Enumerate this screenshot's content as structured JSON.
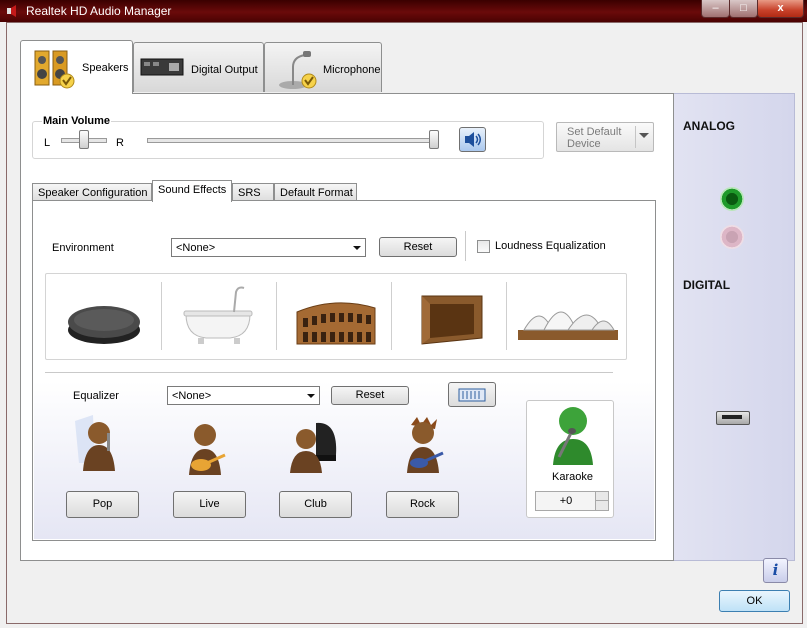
{
  "window": {
    "title": "Realtek HD Audio Manager",
    "minimize": "–",
    "maximize": "□",
    "close": "x"
  },
  "tabs": [
    {
      "label": "Speakers",
      "icon": "speakers-icon"
    },
    {
      "label": "Digital Output",
      "icon": "digital-output-icon"
    },
    {
      "label": "Microphone",
      "icon": "microphone-icon"
    }
  ],
  "volume": {
    "title": "Main Volume",
    "left": "L",
    "right": "R",
    "balance": 0.5,
    "level": 1.0
  },
  "set_default": {
    "label_line1": "Set Default",
    "label_line2": "Device"
  },
  "subtabs": [
    "Speaker Configuration",
    "Sound Effects",
    "SRS",
    "Default Format"
  ],
  "environment": {
    "label": "Environment",
    "value": "<None>",
    "reset": "Reset",
    "loudness": "Loudness Equalization",
    "loudness_checked": false
  },
  "environments": [
    "stone-disc",
    "bathroom",
    "colosseum",
    "room",
    "opera-house"
  ],
  "equalizer": {
    "label": "Equalizer",
    "value": "<None>",
    "reset": "Reset",
    "presets": [
      "Pop",
      "Live",
      "Club",
      "Rock"
    ]
  },
  "karaoke": {
    "label": "Karaoke",
    "value": "+0"
  },
  "right_panel": {
    "analog": "ANALOG",
    "digital": "DIGITAL"
  },
  "info_label": "i",
  "ok_label": "OK",
  "colors": {
    "titlebar": "#5a0d0d",
    "jack_green": "#1f9a2a",
    "jack_pink": "#ddb6c6",
    "ok_border": "#3c7fb1"
  }
}
